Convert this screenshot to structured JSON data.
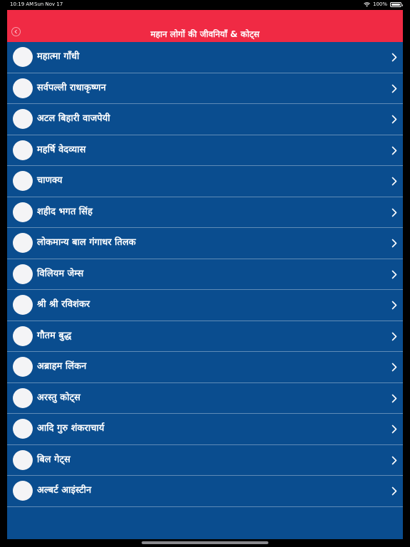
{
  "status_bar": {
    "time": "10:19 AM",
    "date": "Sun Nov 17",
    "battery": "100%"
  },
  "header": {
    "title": "महान लोगों की जीवनियाँ & कोट्स",
    "back_icon": "chevron-left-icon"
  },
  "colors": {
    "header_bg": "#f02a44",
    "list_bg": "#0a4d8f",
    "text": "#ffffff"
  },
  "list": {
    "items": [
      {
        "label": "महात्मा गाँधी"
      },
      {
        "label": "सर्वपल्ली राधाकृष्णन"
      },
      {
        "label": "अटल बिहारी वाजपेयी"
      },
      {
        "label": "महर्षि वेदव्यास"
      },
      {
        "label": "चाणक्य"
      },
      {
        "label": "शहीद भगत सिंह"
      },
      {
        "label": "लोकमान्य बाल गंगाधर तिलक"
      },
      {
        "label": "विलियम जेम्स"
      },
      {
        "label": "श्री श्री रविशंकर"
      },
      {
        "label": "गौतम बुद्ध"
      },
      {
        "label": "अब्राहम लिंकन"
      },
      {
        "label": "अरस्तु कोट्स"
      },
      {
        "label": "आदि गुरु शंकराचार्य"
      },
      {
        "label": "बिल गेट्स"
      },
      {
        "label": "अल्बर्ट आइंस्टीन"
      }
    ]
  }
}
